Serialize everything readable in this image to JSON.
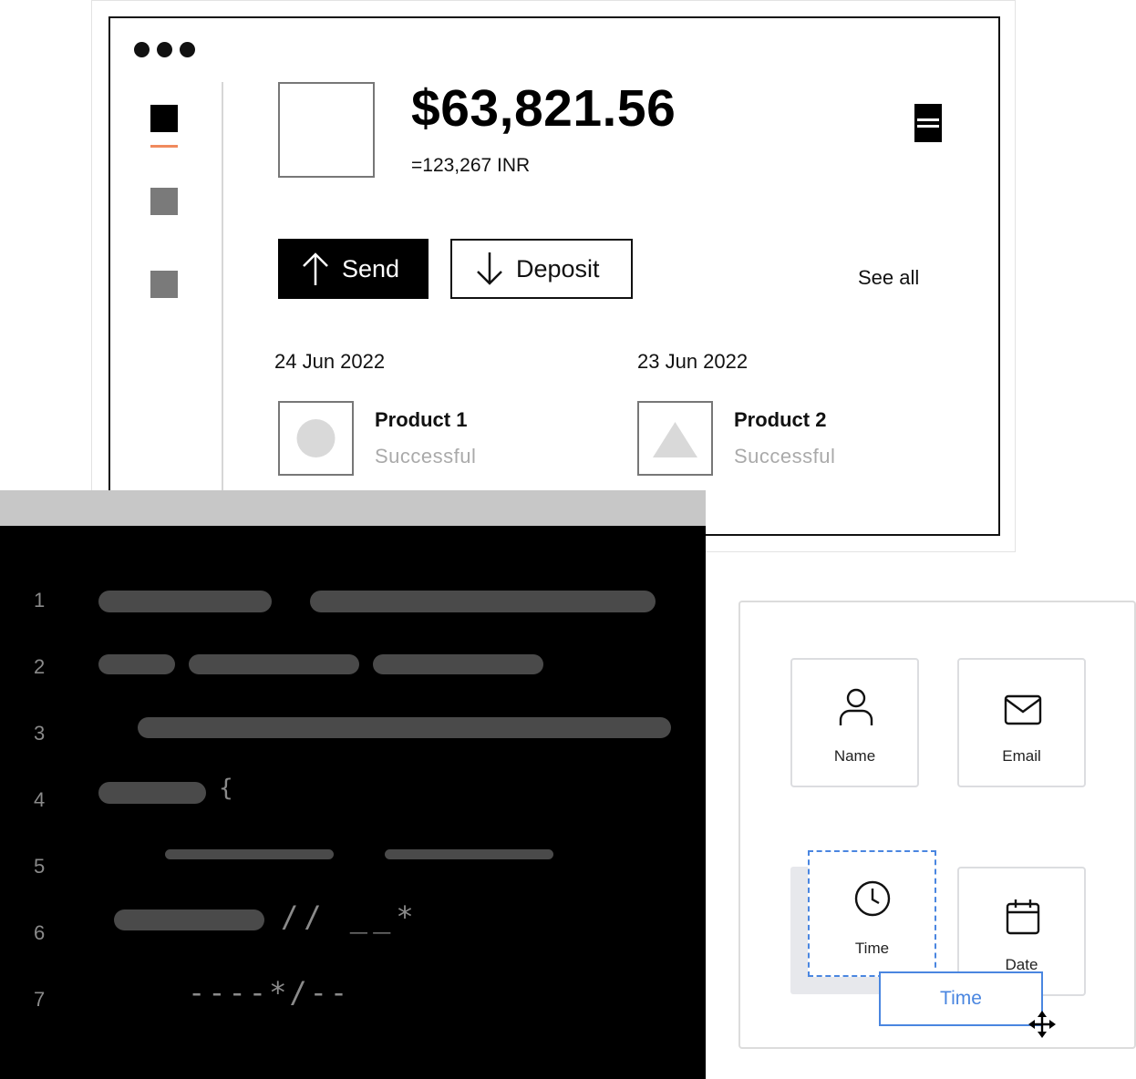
{
  "wallet": {
    "balance": "$63,821.56",
    "converted": "=123,267 INR",
    "send_label": "Send",
    "deposit_label": "Deposit",
    "see_all_label": "See all",
    "accent_color": "#f08a5d",
    "transactions": [
      {
        "date": "24 Jun 2022",
        "name": "Product 1",
        "status": "Successful",
        "icon": "circle-icon"
      },
      {
        "date": "23 Jun 2022",
        "name": "Product 2",
        "status": "Successful",
        "icon": "triangle-icon"
      }
    ]
  },
  "editor": {
    "line_numbers": [
      "1",
      "2",
      "3",
      "4",
      "5",
      "6",
      "7"
    ],
    "brace": "{",
    "comment": "// __*",
    "closing": "----*/--"
  },
  "builder": {
    "fields": {
      "name": "Name",
      "email": "Email",
      "time": "Time",
      "date": "Date"
    },
    "drag_label": "Time",
    "highlight_color": "#4a86e0"
  }
}
